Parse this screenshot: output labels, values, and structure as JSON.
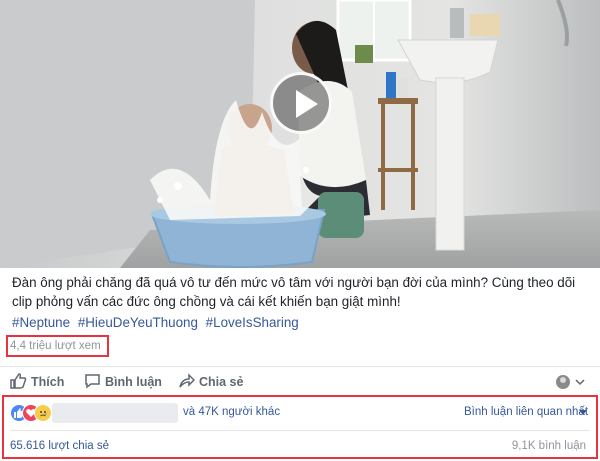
{
  "post": {
    "caption": "Đàn ông phải chăng đã quá vô tư đến mức vô tâm với người bạn đời của mình? Cùng theo dõi clip phỏng vấn các đức ông chồng và cái kết khiến bạn giật mình!",
    "hashtags": [
      "#Neptune",
      "#HieuDeYeuThuong",
      "#LoveIsSharing"
    ],
    "views": "4,4 triệu lượt xem"
  },
  "actions": {
    "like": "Thích",
    "comment": "Bình luận",
    "share": "Chia sẻ"
  },
  "reactions": {
    "types": [
      "like-icon",
      "love-icon",
      "sad-icon"
    ],
    "others": "và 47K người khác",
    "relevant": "Bình luận liên quan nhất",
    "shares": "65.616 lượt chia sẻ",
    "comments": "9,1K bình luận"
  },
  "colors": {
    "link": "#365899",
    "highlight": "#e8333e",
    "muted": "#90949c"
  }
}
